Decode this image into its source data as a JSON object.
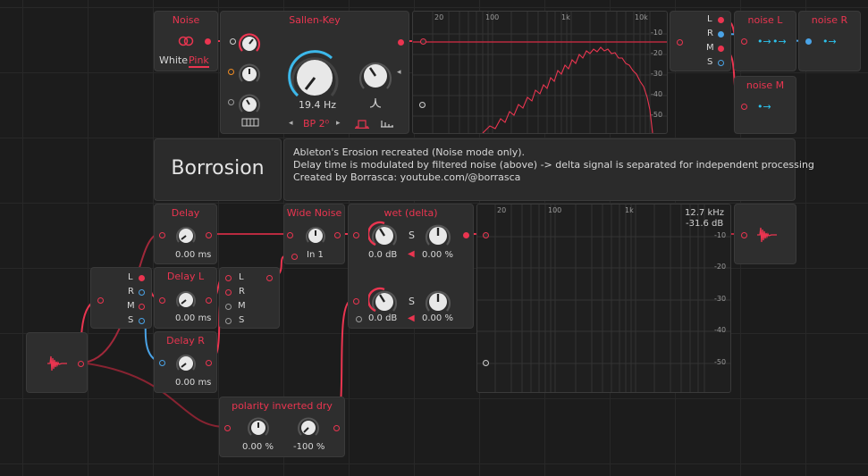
{
  "noise": {
    "title": "Noise",
    "mode_white": "White",
    "mode_pink": "Pink"
  },
  "sallen_key": {
    "title": "Sallen-Key",
    "freq": "19.4 Hz",
    "mode": "BP 2⁰"
  },
  "spectrum_top": {
    "x_ticks": [
      "20",
      "100",
      "1k",
      "10k"
    ],
    "y_ticks": [
      "-10",
      "-20",
      "-30",
      "-40",
      "-50"
    ]
  },
  "splitter_top": {
    "items": [
      "L",
      "R",
      "M",
      "S"
    ]
  },
  "noise_l": {
    "title": "noise L"
  },
  "noise_r": {
    "title": "noise R"
  },
  "noise_m": {
    "title": "noise M"
  },
  "name_panel": {
    "title": "Borrosion"
  },
  "description": {
    "line1": "Ableton's Erosion recreated (Noise mode only).",
    "line2": "Delay time is modulated by filtered noise (above) -> delta signal is separated for independent processing",
    "line3": "Created by Borrasca: youtube.com/@borrasca"
  },
  "delay": {
    "title": "Delay",
    "value": "0.00 ms"
  },
  "delay_l": {
    "title": "Delay L",
    "value": "0.00 ms"
  },
  "delay_r": {
    "title": "Delay R",
    "value": "0.00 ms"
  },
  "splitter_left": {
    "items": [
      "L",
      "R",
      "M",
      "S"
    ]
  },
  "merger": {
    "items": [
      "L",
      "R",
      "M",
      "S"
    ]
  },
  "wide_noise": {
    "title": "Wide Noise",
    "value": "In 1"
  },
  "wet_delta": {
    "title": "wet (delta)",
    "gain1": "0.0 dB",
    "mix1": "0.00 %",
    "gain2": "0.0 dB",
    "mix2": "0.00 %",
    "s_label": "S"
  },
  "spectrum_bottom": {
    "x_ticks": [
      "20",
      "100",
      "1k"
    ],
    "y_ticks": [
      "-10",
      "-20",
      "-30",
      "-40",
      "-50"
    ],
    "readout_freq": "12.7 kHz",
    "readout_db": "-31.6 dB"
  },
  "polarity": {
    "title": "polarity inverted dry",
    "value1": "0.00 %",
    "value2": "-100 %"
  },
  "colors": {
    "accent": "#ea3550",
    "blue": "#4aa3e6",
    "cyan": "#2cc3ee",
    "orange": "#f08c24"
  },
  "icons": [
    "audio-input-icon",
    "audio-output-icon",
    "noise-rings-icon",
    "piano-keys-icon",
    "filter-shape-icon",
    "chevron-left-icon",
    "chevron-right-icon",
    "speaker-icon"
  ]
}
